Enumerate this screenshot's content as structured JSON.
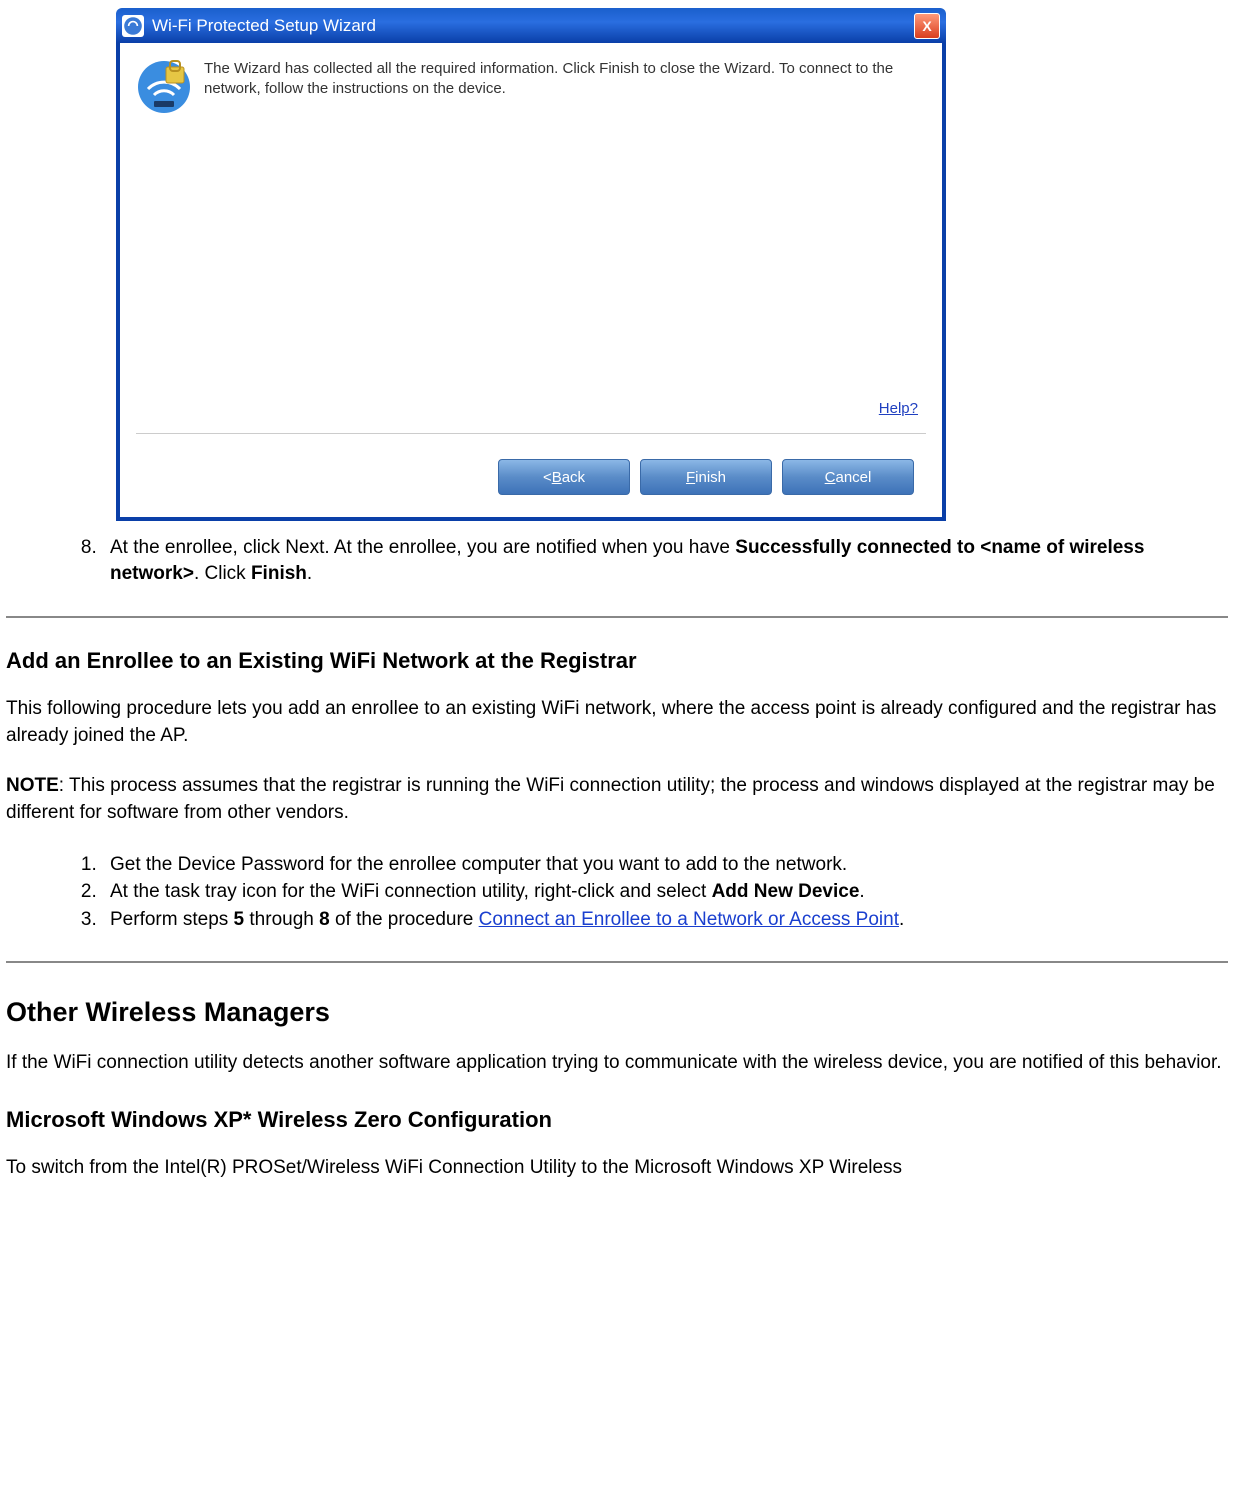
{
  "dialog": {
    "title": "Wi-Fi Protected Setup Wizard",
    "close_label": "X",
    "body_text": "The Wizard has collected all the required information. Click Finish to close the Wizard. To connect to the network, follow the instructions on the device.",
    "help_label": "Help?",
    "buttons": {
      "back_prefix": "< ",
      "back_ul": "B",
      "back_rest": "ack",
      "finish_ul": "F",
      "finish_rest": "inish",
      "cancel_ul": "C",
      "cancel_rest": "ancel"
    }
  },
  "step8": {
    "number_start": 8,
    "text_a": "At the enrollee, click Next. At the enrollee, you are notified when you have ",
    "bold_a": "Successfully connected to <name of wireless network>",
    "text_b": ". Click ",
    "bold_b": "Finish",
    "text_c": "."
  },
  "section_enrollee": {
    "heading": "Add an Enrollee to an Existing WiFi Network at the Registrar",
    "para1": "This following procedure lets you add an enrollee to an existing WiFi network, where the access point is already configured and the registrar has already joined the AP.",
    "note_label": "NOTE",
    "note_text": ": This process assumes that the registrar is running the WiFi connection utility; the process and windows displayed at the registrar may be different for software from other vendors.",
    "steps": {
      "s1": "Get the Device Password for the enrollee computer that you want to add to the network.",
      "s2_a": "At the task tray icon for the WiFi connection utility, right-click and select ",
      "s2_bold": "Add New Device",
      "s2_b": ".",
      "s3_a": "Perform steps ",
      "s3_b1": "5",
      "s3_mid": " through ",
      "s3_b2": "8",
      "s3_c": " of the procedure ",
      "s3_link": "Connect an Enrollee to a Network or Access Point",
      "s3_d": "."
    }
  },
  "section_other": {
    "heading": "Other Wireless Managers",
    "para": "If the WiFi connection utility detects another software application trying to communicate with the wireless device, you are notified of this behavior.",
    "sub_heading": "Microsoft Windows XP* Wireless Zero Configuration",
    "trailing": "To switch from the Intel(R) PROSet/Wireless WiFi Connection Utility to the Microsoft Windows XP Wireless"
  }
}
